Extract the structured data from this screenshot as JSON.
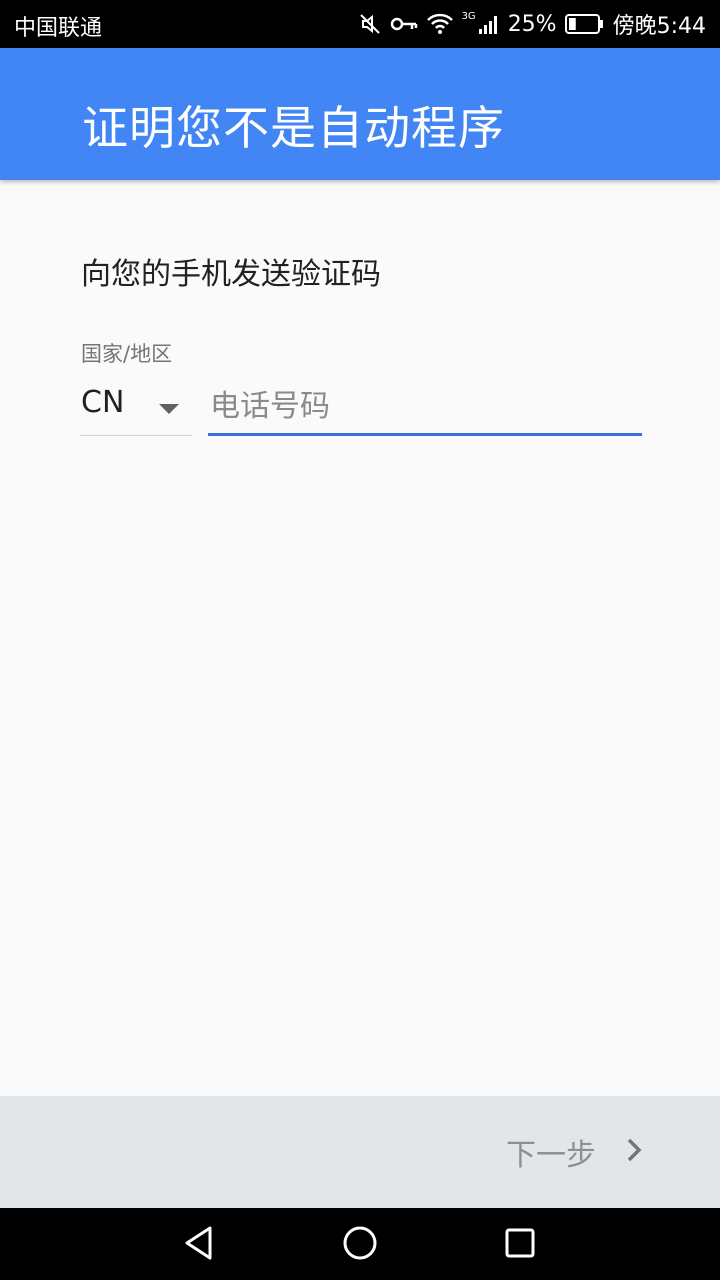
{
  "status_bar": {
    "carrier": "中国联通",
    "network_type": "3G",
    "battery_percent": "25%",
    "time": "傍晚5:44",
    "battery_level": 0.25
  },
  "app_bar": {
    "title": "证明您不是自动程序"
  },
  "form": {
    "heading": "向您的手机发送验证码",
    "country_label": "国家/地区",
    "country_value": "CN",
    "phone_placeholder": "电话号码",
    "phone_value": ""
  },
  "footer": {
    "next_label": "下一步"
  },
  "colors": {
    "app_bar": "#4285f4",
    "input_underline": "#3f6fd8",
    "bottom_bar": "#e2e6e9"
  },
  "icons": {
    "status": [
      "mute-icon",
      "key-icon",
      "wifi-icon",
      "signal-icon",
      "battery-icon"
    ],
    "dropdown": "arrow-drop-down-icon",
    "next": "chevron-right-icon",
    "nav": [
      "back-icon",
      "home-icon",
      "recents-icon"
    ]
  }
}
